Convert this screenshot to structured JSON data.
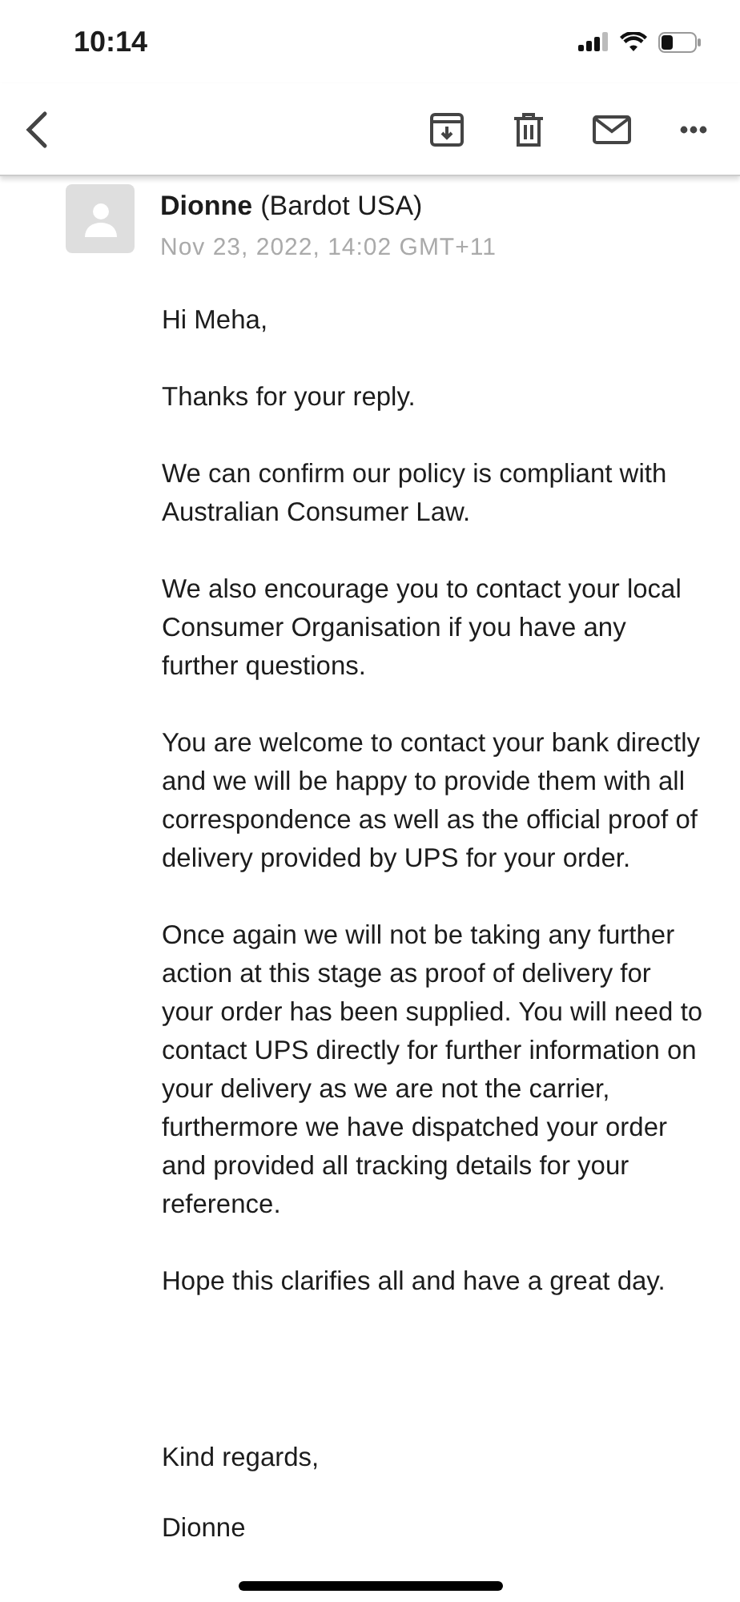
{
  "status_bar": {
    "time": "10:14"
  },
  "message": {
    "sender_name": "Dionne",
    "sender_org": "(Bardot USA)",
    "date": "Nov 23, 2022, 14:02 GMT+11",
    "paragraphs": [
      "Hi Meha,",
      "Thanks for your reply.",
      "We can confirm our policy is compliant with Australian Consumer Law.",
      "We also encourage you to contact your local Consumer Organisation if you have any further questions.",
      "You are welcome to contact your bank directly and we will be happy to provide them with all correspondence as well as the official proof of delivery provided by UPS for your order.",
      "Once again we will not be taking any further action at this stage as proof of delivery for your order has been supplied. You will need to contact UPS directly for further information on your delivery as we are not the carrier, furthermore we have dispatched your order and provided all tracking details for your reference.",
      "Hope this clarifies all and have a great day."
    ],
    "closing": "Kind regards,",
    "signature": "Dionne"
  }
}
